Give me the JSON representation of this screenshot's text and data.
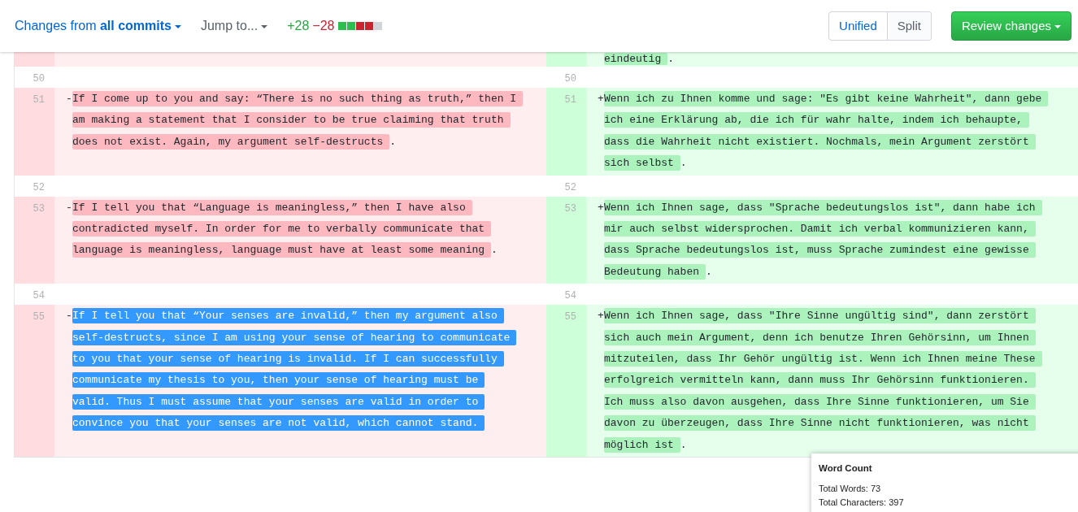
{
  "header": {
    "changes_label": "Changes from **all commits**",
    "jump_label": "Jump to...",
    "additions": "+28",
    "deletions": "−28",
    "diffstat": [
      {
        "kind": "added"
      },
      {
        "kind": "added"
      },
      {
        "kind": "removed"
      },
      {
        "kind": "removed"
      },
      {
        "kind": "neutral"
      }
    ]
  },
  "view_toggle": [
    {
      "label": "Unified",
      "selected": true
    },
    {
      "label": "Split",
      "selected": false
    }
  ],
  "review_button": "Review changes",
  "rows": [
    {
      "kind": "partial",
      "right": {
        "lines": [
          "eindeutig"
        ],
        "tail": "."
      }
    },
    {
      "kind": "context",
      "left": {
        "number": "50"
      },
      "right": {
        "number": "50"
      }
    },
    {
      "kind": "change",
      "left": {
        "number": "51",
        "sign": "-",
        "selected": false,
        "lines": [
          "If I come up to you and say: “There is no such thing as truth,” then I",
          "am making a statement that I consider to be true claiming that truth",
          "does not exist. Again, my argument self-destructs"
        ],
        "tail": "."
      },
      "right": {
        "number": "51",
        "sign": "+",
        "selected": false,
        "lines": [
          "Wenn ich zu Ihnen komme und sage: \"Es gibt keine Wahrheit\", dann gebe",
          "ich eine Erklärung ab, die ich für wahr halte, indem ich behaupte,",
          "dass die Wahrheit nicht existiert. Nochmals, mein Argument zerstört",
          "sich selbst"
        ],
        "tail": "."
      }
    },
    {
      "kind": "context",
      "left": {
        "number": "52"
      },
      "right": {
        "number": "52"
      }
    },
    {
      "kind": "change",
      "left": {
        "number": "53",
        "sign": "-",
        "selected": false,
        "lines": [
          "If I tell you that “Language is meaningless,” then I have also",
          "contradicted myself. In order for me to verbally communicate that",
          "language is meaningless, language must have at least some meaning"
        ],
        "tail": "."
      },
      "right": {
        "number": "53",
        "sign": "+",
        "selected": false,
        "lines": [
          "Wenn ich Ihnen sage, dass \"Sprache bedeutungslos ist\", dann habe ich",
          "mir auch selbst widersprochen. Damit ich verbal kommunizieren kann,",
          "dass Sprache bedeutungslos ist, muss Sprache zumindest eine gewisse",
          "Bedeutung haben"
        ],
        "tail": "."
      }
    },
    {
      "kind": "context",
      "left": {
        "number": "54"
      },
      "right": {
        "number": "54"
      }
    },
    {
      "kind": "change",
      "left": {
        "number": "55",
        "sign": "-",
        "selected": true,
        "lines": [
          "If I tell you that “Your senses are invalid,” then my argument also",
          "self-destructs, since I am using your sense of hearing to communicate",
          "to you that your sense of hearing is invalid. If I can successfully",
          "communicate my thesis to you, then your sense of hearing must be",
          "valid. Thus I must assume that your senses are valid in order to",
          "convince you that your senses are not valid, which cannot stand."
        ]
      },
      "right": {
        "number": "55",
        "sign": "+",
        "selected": false,
        "lines": [
          "Wenn ich Ihnen sage, dass \"Ihre Sinne ungültig sind\", dann zerstört",
          "sich auch mein Argument, denn ich benutze Ihren Gehörsinn, um Ihnen",
          "mitzuteilen, dass Ihr Gehör ungültig ist. Wenn ich Ihnen meine These",
          "erfolgreich vermitteln kann, dann muss Ihr Gehörsinn funktionieren.",
          "Ich muss also davon ausgehen, dass Ihre Sinne funktionieren, um Sie",
          "davon zu überzeugen, dass Ihre Sinne nicht funktionieren, was nicht",
          "möglich ist"
        ],
        "tail": "."
      }
    }
  ],
  "word_count": {
    "title": "Word Count",
    "lines": [
      "Total Words: 73",
      "Total Characters: 397"
    ]
  }
}
